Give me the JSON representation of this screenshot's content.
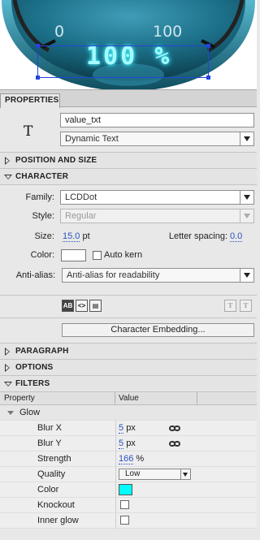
{
  "stage": {
    "scale_min": "0",
    "scale_max": "100",
    "readout": "100 %",
    "colors": {
      "bezel": "#1f5a6b",
      "readout_glow": "#4ff5ff",
      "selection": "#2244dd"
    }
  },
  "panel": {
    "tab_label": "PROPERTIES",
    "instance": {
      "tool_icon": "T",
      "name_value": "value_txt",
      "text_type": "Dynamic Text"
    },
    "sections": {
      "position_size": "POSITION AND SIZE",
      "character": "CHARACTER",
      "paragraph": "PARAGRAPH",
      "options": "OPTIONS",
      "filters": "FILTERS"
    },
    "character": {
      "family_label": "Family:",
      "family_value": "LCDDot",
      "style_label": "Style:",
      "style_value": "Regular",
      "size_label": "Size:",
      "size_value": "15.0",
      "size_unit": "pt",
      "letter_spacing_label": "Letter spacing:",
      "letter_spacing_value": "0.0",
      "color_label": "Color:",
      "color_value": "#ffffff",
      "auto_kern_label": "Auto kern",
      "antialias_label": "Anti-alias:",
      "antialias_value": "Anti-alias for readability",
      "format_icons": [
        "selectable-text-icon",
        "render-html-icon",
        "border-icon",
        "superscript-icon",
        "subscript-icon"
      ],
      "format_glyphs": {
        "selectable": "AB",
        "html": "<>",
        "border": "▤",
        "superscript": "T",
        "subscript": "T"
      },
      "embed_button": "Character Embedding..."
    },
    "filters": {
      "col_property": "Property",
      "col_value": "Value",
      "group_name": "Glow",
      "rows": {
        "blur_x": {
          "label": "Blur X",
          "value": "5",
          "unit": "px"
        },
        "blur_y": {
          "label": "Blur Y",
          "value": "5",
          "unit": "px"
        },
        "strength": {
          "label": "Strength",
          "value": "166",
          "unit": "%"
        },
        "quality": {
          "label": "Quality",
          "value": "Low"
        },
        "color": {
          "label": "Color",
          "value": "#00ffff"
        },
        "knockout": {
          "label": "Knockout",
          "checked": false
        },
        "inner_glow": {
          "label": "Inner glow",
          "checked": false
        }
      }
    }
  }
}
